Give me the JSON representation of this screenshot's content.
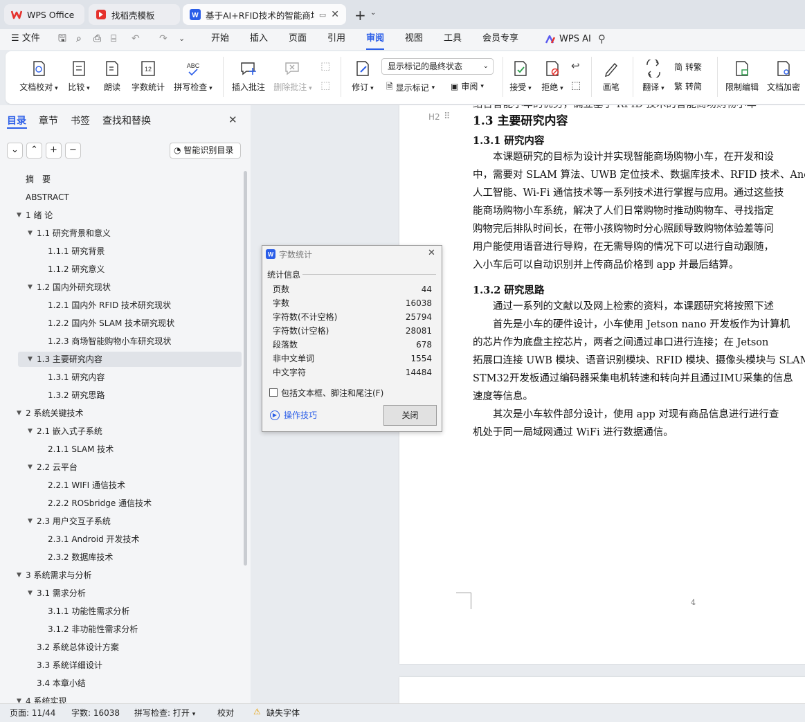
{
  "tabs": [
    {
      "label": "WPS Office",
      "icon": "wps-logo-icon"
    },
    {
      "label": "找稻壳模板",
      "icon": "docer-logo-icon"
    },
    {
      "label": "基于AI+RFID技术的智能商场购物小车",
      "icon": "writer-doc-icon"
    }
  ],
  "menu": {
    "file": "文件",
    "items": [
      "开始",
      "插入",
      "页面",
      "引用",
      "审阅",
      "视图",
      "工具",
      "会员专享"
    ],
    "active": "审阅",
    "ai": "WPS AI"
  },
  "ribbon": {
    "doc_check": "文档校对",
    "compare": "比较",
    "read_aloud": "朗读",
    "word_count": "字数统计",
    "spell_check": "拼写检查",
    "insert_comment": "插入批注",
    "delete_comment": "删除批注",
    "revise": "修订",
    "display_mode": "显示标记的最终状态",
    "show_markup": "显示标记",
    "review": "审阅",
    "accept": "接受",
    "reject": "拒绝",
    "ink": "画笔",
    "translate": "翻译",
    "to_traditional": "转繁",
    "to_simplified": "转简",
    "restrict_edit": "限制编辑",
    "encrypt": "文档加密"
  },
  "nav": {
    "tabs": [
      "目录",
      "章节",
      "书签",
      "查找和替换"
    ],
    "smart_toc": "智能识别目录",
    "toc": [
      {
        "label": "摘　要",
        "level": 1,
        "toggle": false
      },
      {
        "label": "ABSTRACT",
        "level": 1,
        "toggle": false
      },
      {
        "label": "1 绪  论",
        "level": 1,
        "toggle": true
      },
      {
        "label": "1.1 研究背景和意义",
        "level": 2,
        "toggle": true
      },
      {
        "label": "1.1.1 研究背景",
        "level": 3,
        "toggle": false
      },
      {
        "label": "1.1.2 研究意义",
        "level": 3,
        "toggle": false
      },
      {
        "label": "1.2 国内外研究现状",
        "level": 2,
        "toggle": true
      },
      {
        "label": "1.2.1 国内外 RFID 技术研究现状",
        "level": 3,
        "toggle": false
      },
      {
        "label": "1.2.2 国内外 SLAM 技术研究现状",
        "level": 3,
        "toggle": false
      },
      {
        "label": "1.2.3 商场智能购物小车研究现状",
        "level": 3,
        "toggle": false
      },
      {
        "label": "1.3 主要研究内容",
        "level": 2,
        "toggle": true,
        "selected": true
      },
      {
        "label": "1.3.1 研究内容",
        "level": 3,
        "toggle": false
      },
      {
        "label": "1.3.2 研究思路",
        "level": 3,
        "toggle": false
      },
      {
        "label": "2  系统关键技术",
        "level": 1,
        "toggle": true
      },
      {
        "label": "2.1 嵌入式子系统",
        "level": 2,
        "toggle": true
      },
      {
        "label": "2.1.1 SLAM 技术",
        "level": 3,
        "toggle": false
      },
      {
        "label": "2.2 云平台",
        "level": 2,
        "toggle": true
      },
      {
        "label": "2.2.1 WIFI 通信技术",
        "level": 3,
        "toggle": false
      },
      {
        "label": "2.2.2 ROSbridge 通信技术",
        "level": 3,
        "toggle": false
      },
      {
        "label": "2.3 用户交互子系统",
        "level": 2,
        "toggle": true
      },
      {
        "label": "2.3.1 Android 开发技术",
        "level": 3,
        "toggle": false
      },
      {
        "label": "2.3.2  数据库技术",
        "level": 3,
        "toggle": false
      },
      {
        "label": "3 系统需求与分析",
        "level": 1,
        "toggle": true
      },
      {
        "label": "3.1 需求分析",
        "level": 2,
        "toggle": true
      },
      {
        "label": "3.1.1  功能性需求分析",
        "level": 3,
        "toggle": false
      },
      {
        "label": "3.1.2  非功能性需求分析",
        "level": 3,
        "toggle": false
      },
      {
        "label": "3.2 系统总体设计方案",
        "level": 2,
        "toggle": false
      },
      {
        "label": "3.3 系统详细设计",
        "level": 2,
        "toggle": false
      },
      {
        "label": "3.4 本章小结",
        "level": 2,
        "toggle": false
      },
      {
        "label": "4  系统实现",
        "level": 1,
        "toggle": true
      }
    ]
  },
  "document": {
    "top_cut": "结合智能小车的优势，确立基于 RFID 技术的智能商场购物小车",
    "heading_level_marker": "H2",
    "h2": "1.3 主要研究内容",
    "h3a": "1.3.1 研究内容",
    "para1": [
      "　　本课题研究的目标为设计并实现智能商场购物小车，在开发和设",
      "中，需要对 SLAM 算法、UWB 定位技术、数据库技术、RFID 技术、Andr",
      "人工智能、Wi-Fi 通信技术等一系列技术进行掌握与应用。通过这些技",
      "能商场购物小车系统，解决了人们日常购物时推动购物车、寻找指定",
      "购物完后排队时间长，在带小孩购物时分心照顾导致购物体验差等问",
      "用户能使用语音进行导购，在无需导购的情况下可以进行自动跟随，",
      "入小车后可以自动识别并上传商品价格到 app 并最后结算。"
    ],
    "h3b": "1.3.2 研究思路",
    "para2": [
      "　　通过一系列的文献以及网上检索的资料，本课题研究将按照下述",
      "　　首先是小车的硬件设计，小车使用 Jetson nano 开发板作为计算机",
      "的芯片作为底盘主控芯片，两者之间通过串口进行连接；在 Jetson",
      "拓展口连接 UWB 模块、语音识别模块、RFID 模块、摄像头模块与 SLAM",
      "STM32开发板通过编码器采集电机转速和转向并且通过IMU采集的信息",
      "速度等信息。",
      "　　其次是小车软件部分设计，使用 app 对现有商品信息进行进行查",
      "机处于同一局域网通过 WiFi 进行数据通信。"
    ],
    "page_number": "4"
  },
  "dialog": {
    "title": "字数统计",
    "section": "统计信息",
    "stats": [
      {
        "label": "页数",
        "value": "44"
      },
      {
        "label": "字数",
        "value": "16038"
      },
      {
        "label": "字符数(不计空格)",
        "value": "25794"
      },
      {
        "label": "字符数(计空格)",
        "value": "28081"
      },
      {
        "label": "段落数",
        "value": "678"
      },
      {
        "label": "非中文单词",
        "value": "1554"
      },
      {
        "label": "中文字符",
        "value": "14484"
      }
    ],
    "include_label": "包括文本框、脚注和尾注(F)",
    "include_checked": false,
    "tips": "操作技巧",
    "close": "关闭"
  },
  "status": {
    "page": "页面: 11/44",
    "words": "字数: 16038",
    "spell": "拼写检查: 打开",
    "proof": "校对",
    "missing_font": "缺失字体"
  },
  "colors": {
    "accent": "#2b5ee8",
    "wps_red": "#e5322d"
  }
}
